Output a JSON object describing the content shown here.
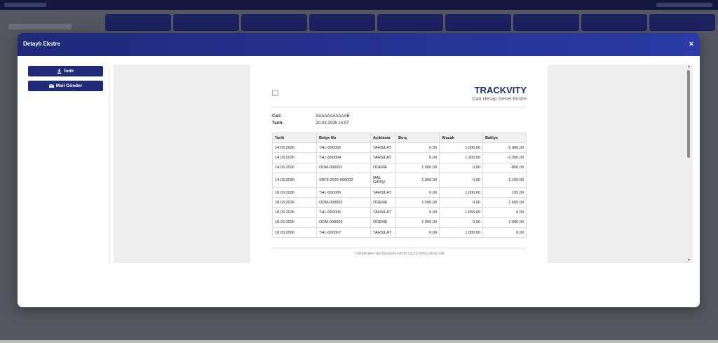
{
  "modal": {
    "title": "Detaylı Ekstre",
    "close_label": "×"
  },
  "actions": {
    "download_label": "İndir",
    "mail_label": "Mail Gönder"
  },
  "document": {
    "brand": "TRACKVITY",
    "subtitle": "Cari Hesap Genel Ekstre",
    "cari_label": "Cari:",
    "cari_value": "AAAAAAAAAAAB",
    "tarih_label": "Tarih:",
    "tarih_value": "20.03.2026 14:07",
    "footnote": "YUKARDAKİ ÜRÜNLERİN KAYDI OLUŞTURULMUŞTUR"
  },
  "table": {
    "headers": [
      "Tarih",
      "Belge No",
      "Açıklama",
      "Borç",
      "Alacak",
      "Bakiye"
    ],
    "rows": [
      [
        "14.03.2026",
        "THL-000002",
        "TAHSİLAT",
        "0,00",
        "1.000,00",
        "-1.000,00"
      ],
      [
        "14.03.2026",
        "THL-000004",
        "TAHSİLAT",
        "0,00",
        "1.300,00",
        "-2.300,00"
      ],
      [
        "14.03.2026",
        "ODM-000001",
        "ÖDEME",
        "1.500,00",
        "0,00",
        "-800,00"
      ],
      [
        "14.03.2026",
        "SAT9-2026-000002",
        "MAL GİRİŞİ",
        "1.955,00",
        "0,00",
        "1.155,00"
      ],
      [
        "18.03.2026",
        "THL-000005",
        "TAHSİLAT",
        "0,00",
        "1.000,00",
        "155,00"
      ],
      [
        "18.03.2026",
        "ODM-000002",
        "ÖDEME",
        "1.500,00",
        "0,00",
        "1.655,00"
      ],
      [
        "18.03.2026",
        "THL-000006",
        "TAHSİLAT",
        "0,00",
        "1.655,00",
        "0,00"
      ],
      [
        "18.03.2026",
        "ODM-000003",
        "ÖDEME",
        "1.000,00",
        "0,00",
        "1.000,00"
      ],
      [
        "18.03.2026",
        "THL-000007",
        "TAHSİLAT",
        "0,00",
        "1.000,00",
        "0,00"
      ]
    ]
  },
  "icons": {
    "download": "download-icon",
    "mail": "mail-icon",
    "close": "close-icon"
  },
  "colors": {
    "header_gradient_start": "#1e2a78",
    "header_gradient_end": "#2b3aa6",
    "button": "#1f2a78",
    "brand": "#1f2a78"
  }
}
